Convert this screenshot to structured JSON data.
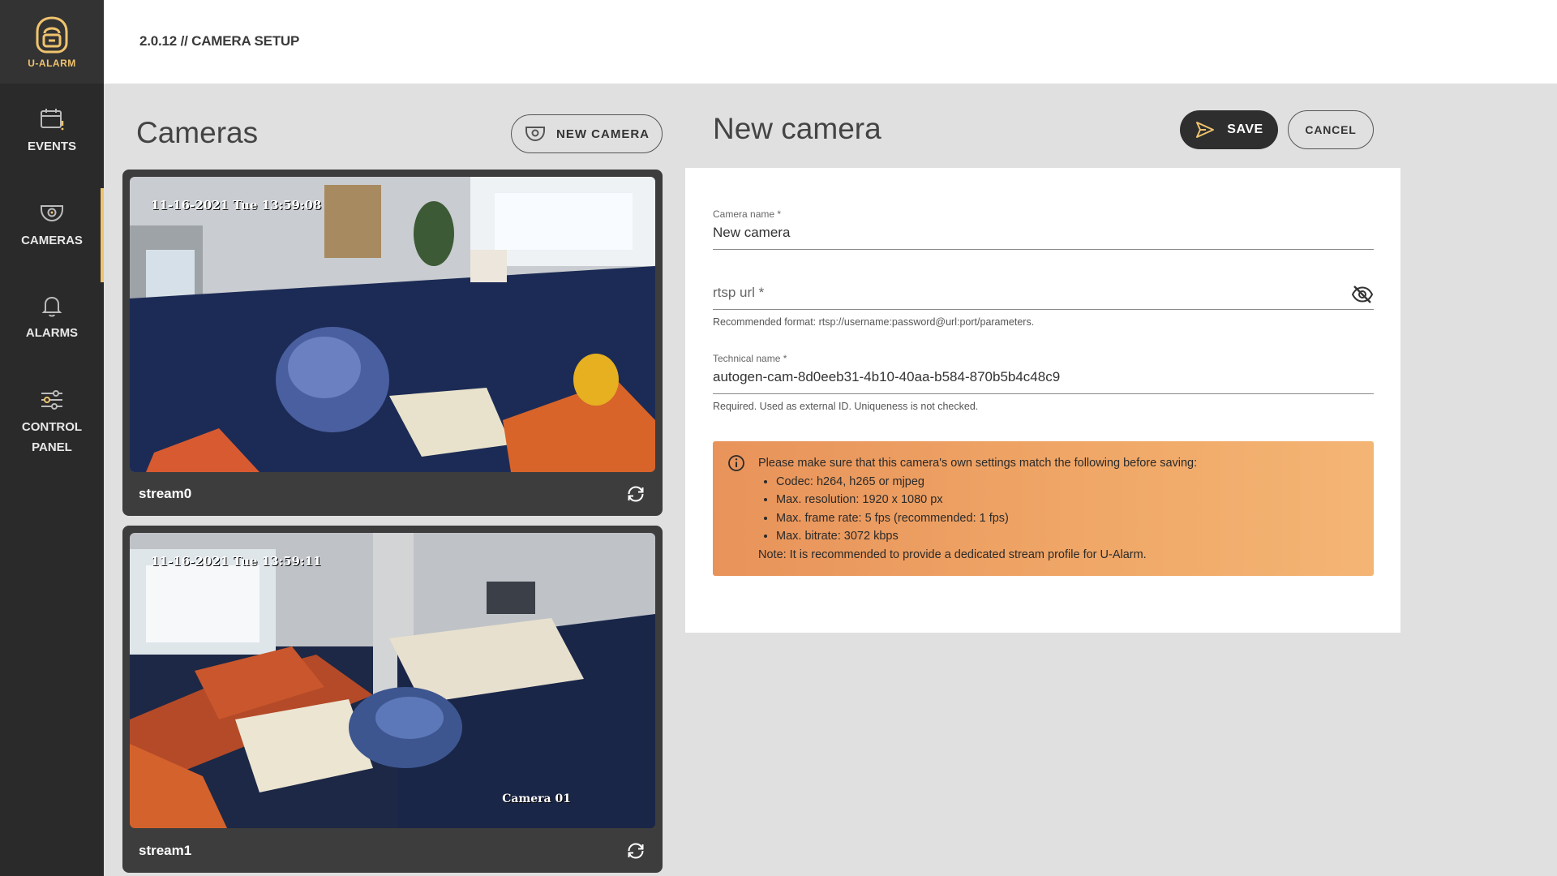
{
  "app": {
    "logo_text": "U-ALARM"
  },
  "nav": [
    {
      "label": "EVENTS",
      "icon": "calendar-alert-icon"
    },
    {
      "label": "CAMERAS",
      "icon": "cctv-camera-icon",
      "active": true
    },
    {
      "label": "ALARMS",
      "icon": "bell-icon"
    },
    {
      "label": "CONTROL",
      "label2": "PANEL",
      "icon": "sliders-icon"
    }
  ],
  "header": {
    "breadcrumb": "2.0.12 // CAMERA SETUP"
  },
  "cameras": {
    "title": "Cameras",
    "new_button": "NEW CAMERA",
    "items": [
      {
        "name": "stream0",
        "timestamp": "11-16-2021 Tue 13:59:08",
        "overlay": ""
      },
      {
        "name": "stream1",
        "timestamp": "11-16-2021 Tue 13:59:11",
        "overlay": "Camera 01"
      }
    ]
  },
  "form": {
    "title": "New camera",
    "save_label": "SAVE",
    "cancel_label": "CANCEL",
    "camera_name": {
      "label": "Camera name *",
      "value": "New camera"
    },
    "rtsp_url": {
      "placeholder": "rtsp url *",
      "helper": "Recommended format: rtsp://username:password@url:port/parameters."
    },
    "technical_name": {
      "label": "Technical name *",
      "value": "autogen-cam-8d0eeb31-4b10-40aa-b584-870b5b4c48c9",
      "helper": "Required. Used as external ID. Uniqueness is not checked."
    },
    "warning": {
      "intro": "Please make sure that this camera's own settings match the following before saving:",
      "items": [
        "Codec: h264, h265 or mjpeg",
        "Max. resolution: 1920 x 1080 px",
        "Max. frame rate: 5 fps (recommended: 1 fps)",
        "Max. bitrate: 3072 kbps"
      ],
      "note": "Note: It is recommended to provide a dedicated stream profile for U-Alarm."
    }
  },
  "colors": {
    "accent": "#f0c36e",
    "sidebar": "#2a2a2a",
    "warning": "#f0a868"
  }
}
